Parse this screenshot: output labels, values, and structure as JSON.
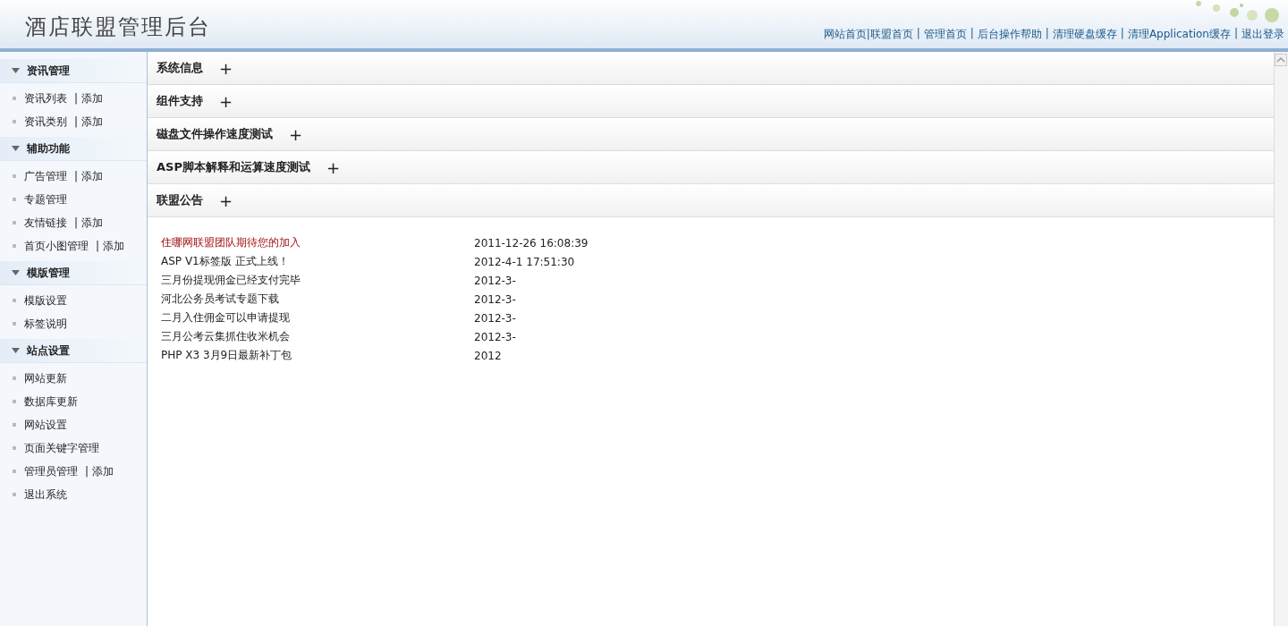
{
  "header": {
    "title": "酒店联盟管理后台",
    "separator": "|",
    "links": [
      "网站首页|联盟首页",
      "管理首页",
      "后台操作帮助",
      "清理硬盘缓存",
      "清理Application缓存",
      "退出登录"
    ]
  },
  "sidebar": [
    {
      "title": "资讯管理",
      "expanded": true,
      "items": [
        {
          "label": "资讯列表",
          "add": "添加"
        },
        {
          "label": "资讯类别",
          "add": "添加"
        }
      ]
    },
    {
      "title": "辅助功能",
      "expanded": true,
      "items": [
        {
          "label": "广告管理",
          "add": "添加"
        },
        {
          "label": "专题管理"
        },
        {
          "label": "友情链接",
          "add": "添加"
        },
        {
          "label": "首页小图管理",
          "add": "添加"
        }
      ]
    },
    {
      "title": "模版管理",
      "expanded": true,
      "items": [
        {
          "label": "模版设置"
        },
        {
          "label": "标签说明"
        }
      ]
    },
    {
      "title": "站点设置",
      "expanded": true,
      "items": [
        {
          "label": "网站更新"
        },
        {
          "label": "数据库更新"
        },
        {
          "label": "网站设置"
        },
        {
          "label": "页面关键字管理"
        },
        {
          "label": "管理员管理",
          "add": "添加"
        },
        {
          "label": "退出系统"
        }
      ]
    }
  ],
  "sections": [
    {
      "title": "系统信息",
      "toggle": "+"
    },
    {
      "title": "组件支持",
      "toggle": "+"
    },
    {
      "title": "磁盘文件操作速度测试",
      "toggle": "+"
    },
    {
      "title": "ASP脚本解释和运算速度测试",
      "toggle": "+"
    },
    {
      "title": "联盟公告",
      "toggle": "+"
    }
  ],
  "notices": [
    {
      "title": "住哪网联盟团队期待您的加入",
      "date": "2011-12-26 16:08:39",
      "highlighted": true
    },
    {
      "title": "ASP V1标签版 正式上线！",
      "date": "2012-4-1 17:51:30",
      "highlighted": false
    },
    {
      "title": "三月份提现佣金已经支付完毕",
      "date": "2012-3-",
      "highlighted": false
    },
    {
      "title": "河北公务员考试专题下载",
      "date": "2012-3-",
      "highlighted": false
    },
    {
      "title": "二月入住佣金可以申请提现",
      "date": "2012-3-",
      "highlighted": false
    },
    {
      "title": "三月公考云集抓住收米机会",
      "date": "2012-3-",
      "highlighted": false
    },
    {
      "title": "PHP X3 3月9日最新补丁包",
      "date": "2012",
      "highlighted": false
    }
  ]
}
